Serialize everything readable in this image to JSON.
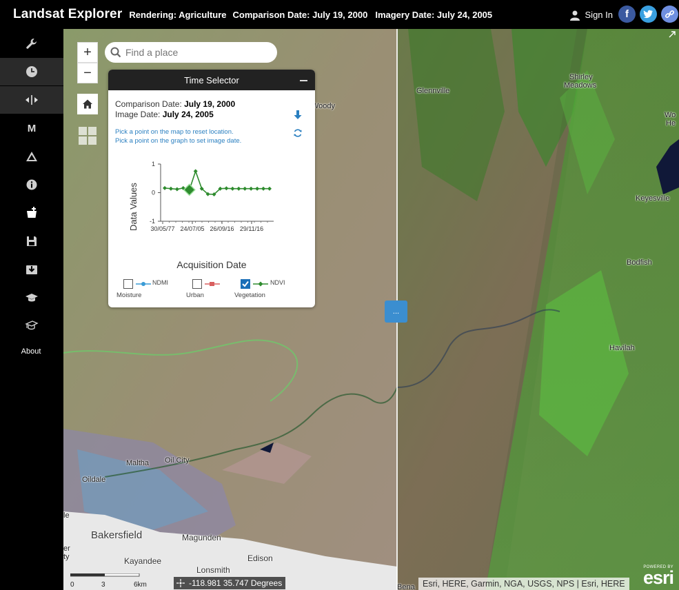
{
  "header": {
    "title": "Landsat Explorer",
    "rendering": "Rendering: Agriculture",
    "comparison": "Comparison Date: July 19, 2000",
    "imagery": "Imagery Date: July 24, 2005",
    "sign_in": "Sign In"
  },
  "sidebar": {
    "about": "About",
    "m_label": "M"
  },
  "map": {
    "search_placeholder": "Find a place",
    "zoom_in": "+",
    "zoom_out": "−",
    "places": {
      "woody": "Woody",
      "glennville": "Glennville",
      "shirley": "Shirley",
      "meadows": "Meadows",
      "wo": "Wo",
      "he": "He",
      "keyesville": "Keyesville",
      "bodfish": "Bodfish",
      "havilah": "Havilah",
      "maltha": "Maltha",
      "oilcity": "Oil City",
      "oildale": "Oildale",
      "le": "le",
      "bakersfield": "Bakersfield",
      "mangunden": "Magunden",
      "er": "er",
      "ty": "ty",
      "kayandee": "Kayandee",
      "edison": "Edison",
      "lonsmith": "Lonsmith",
      "bena": "Bena"
    },
    "scale": {
      "l0": "0",
      "l1": "3",
      "l2": "6km"
    },
    "coords": "-118.981 35.747 Degrees",
    "attribution": "Esri, HERE, Garmin, NGA, USGS, NPS | Esri, HERE",
    "esri_powered": "POWERED BY",
    "esri_logo": "esri",
    "swipe_label": "..."
  },
  "time_selector": {
    "title": "Time Selector",
    "comparison_label": "Comparison Date:",
    "comparison_value": "July 19, 2000",
    "image_label": "Image Date:",
    "image_value": "July 24, 2005",
    "hint1": "Pick a point on the map to reset location.",
    "hint2": "Pick a point on the graph to set image date.",
    "x_axis_title": "Acquisition Date",
    "y_axis_title": "Data Values",
    "legend": [
      {
        "name": "NDMI",
        "category": "Moisture",
        "checked": false,
        "color": "#3a9bd6"
      },
      {
        "name": "Urban",
        "category": "Urban",
        "checked": false,
        "color": "#d95f5f"
      },
      {
        "name": "NDVI",
        "category": "Vegetation",
        "checked": true,
        "color": "#2e8b2e"
      }
    ]
  },
  "chart_data": {
    "type": "line",
    "x_tick_labels": [
      "30/05/77",
      "24/07/05",
      "26/09/16",
      "29/11/16"
    ],
    "y_ticks": [
      "1",
      "0",
      "-1"
    ],
    "ylim": [
      -1,
      1
    ],
    "series": [
      {
        "name": "NDVI",
        "color": "#2e8b2e",
        "values": [
          0.16,
          0.14,
          0.12,
          0.16,
          0.1,
          0.75,
          0.14,
          -0.05,
          -0.06,
          0.14,
          0.15,
          0.14,
          0.14,
          0.14,
          0.14,
          0.14,
          0.14,
          0.14
        ],
        "selected_index": 4
      }
    ]
  }
}
